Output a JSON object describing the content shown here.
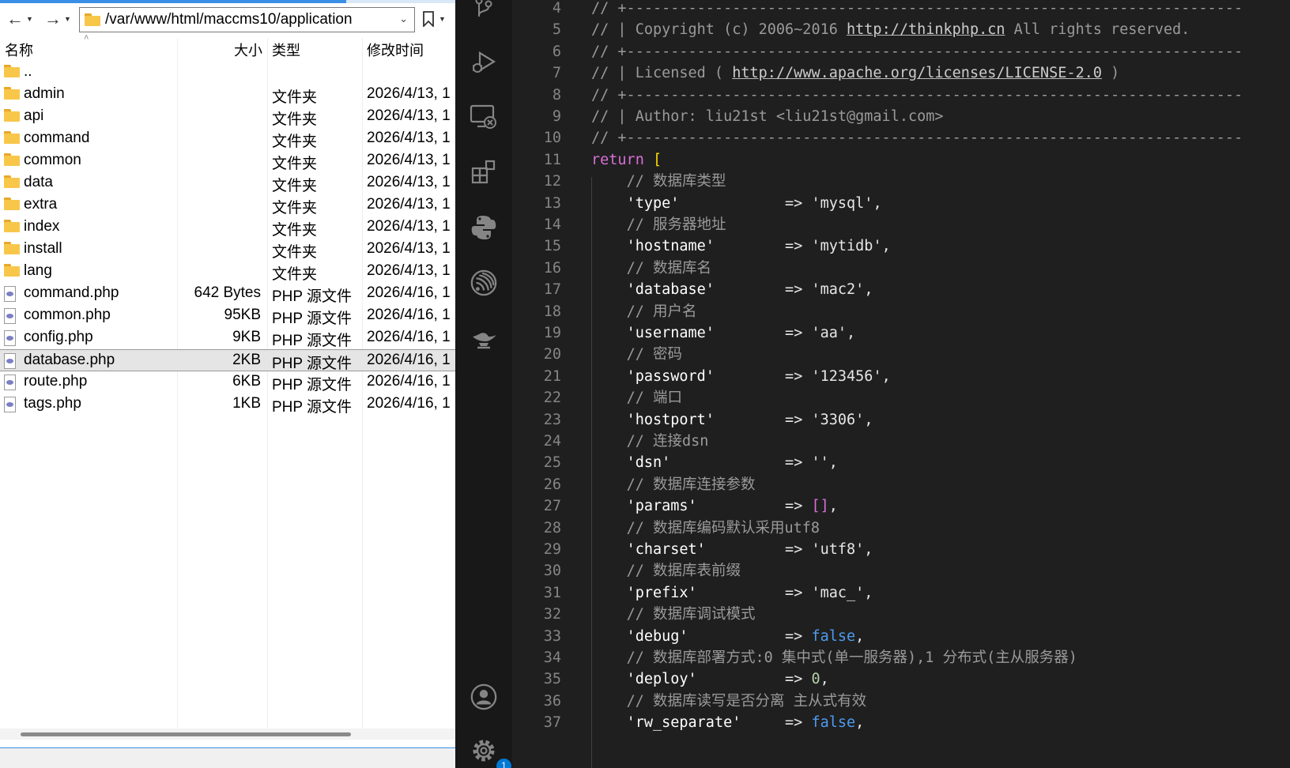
{
  "explorer": {
    "path": "/var/www/html/maccms10/application",
    "columns": {
      "name": "名称",
      "size": "大小",
      "type": "类型",
      "modified": "修改时间"
    },
    "files": [
      {
        "name": "..",
        "size": "",
        "type": "",
        "modified": "",
        "icon": "folder-icon",
        "selected": false
      },
      {
        "name": "admin",
        "size": "",
        "type": "文件夹",
        "modified": "2026/4/13, 1",
        "icon": "folder-icon",
        "selected": false
      },
      {
        "name": "api",
        "size": "",
        "type": "文件夹",
        "modified": "2026/4/13, 1",
        "icon": "folder-icon",
        "selected": false
      },
      {
        "name": "command",
        "size": "",
        "type": "文件夹",
        "modified": "2026/4/13, 1",
        "icon": "folder-icon",
        "selected": false
      },
      {
        "name": "common",
        "size": "",
        "type": "文件夹",
        "modified": "2026/4/13, 1",
        "icon": "folder-icon",
        "selected": false
      },
      {
        "name": "data",
        "size": "",
        "type": "文件夹",
        "modified": "2026/4/13, 1",
        "icon": "folder-icon",
        "selected": false
      },
      {
        "name": "extra",
        "size": "",
        "type": "文件夹",
        "modified": "2026/4/13, 1",
        "icon": "folder-icon",
        "selected": false
      },
      {
        "name": "index",
        "size": "",
        "type": "文件夹",
        "modified": "2026/4/13, 1",
        "icon": "folder-icon",
        "selected": false
      },
      {
        "name": "install",
        "size": "",
        "type": "文件夹",
        "modified": "2026/4/13, 1",
        "icon": "folder-icon",
        "selected": false
      },
      {
        "name": "lang",
        "size": "",
        "type": "文件夹",
        "modified": "2026/4/13, 1",
        "icon": "folder-icon",
        "selected": false
      },
      {
        "name": "command.php",
        "size": "642 Bytes",
        "type": "PHP 源文件",
        "modified": "2026/4/16, 1",
        "icon": "php-file-icon",
        "selected": false
      },
      {
        "name": "common.php",
        "size": "95KB",
        "type": "PHP 源文件",
        "modified": "2026/4/16, 1",
        "icon": "php-file-icon",
        "selected": false
      },
      {
        "name": "config.php",
        "size": "9KB",
        "type": "PHP 源文件",
        "modified": "2026/4/16, 1",
        "icon": "php-file-icon",
        "selected": false
      },
      {
        "name": "database.php",
        "size": "2KB",
        "type": "PHP 源文件",
        "modified": "2026/4/16, 1",
        "icon": "php-file-icon",
        "selected": true
      },
      {
        "name": "route.php",
        "size": "6KB",
        "type": "PHP 源文件",
        "modified": "2026/4/16, 1",
        "icon": "php-file-icon",
        "selected": false
      },
      {
        "name": "tags.php",
        "size": "1KB",
        "type": "PHP 源文件",
        "modified": "2026/4/16, 1",
        "icon": "php-file-icon",
        "selected": false
      }
    ]
  },
  "activity_bar": {
    "icons": [
      "source-control-icon",
      "run-debug-icon",
      "remote-explorer-icon",
      "extensions-icon",
      "python-icon",
      "esp-idf-icon",
      "genie-lamp-icon",
      "accounts-icon",
      "settings-gear-icon"
    ],
    "settings_badge": "1"
  },
  "editor": {
    "lines": [
      {
        "n": "4",
        "tokens": [
          [
            "cmt",
            "// +----------------------------------------------------------------------"
          ]
        ]
      },
      {
        "n": "5",
        "tokens": [
          [
            "cmt",
            "// | Copyright (c) 2006~2016 "
          ],
          [
            "link",
            "http://thinkphp.cn"
          ],
          [
            "cmt",
            " All rights reserved."
          ]
        ]
      },
      {
        "n": "6",
        "tokens": [
          [
            "cmt",
            "// +----------------------------------------------------------------------"
          ]
        ]
      },
      {
        "n": "7",
        "tokens": [
          [
            "cmt",
            "// | Licensed ( "
          ],
          [
            "link",
            "http://www.apache.org/licenses/LICENSE-2.0"
          ],
          [
            "cmt",
            " )"
          ]
        ]
      },
      {
        "n": "8",
        "tokens": [
          [
            "cmt",
            "// +----------------------------------------------------------------------"
          ]
        ]
      },
      {
        "n": "9",
        "tokens": [
          [
            "cmt",
            "// | Author: liu21st <liu21st@gmail.com>"
          ]
        ]
      },
      {
        "n": "10",
        "tokens": [
          [
            "cmt",
            "// +----------------------------------------------------------------------"
          ]
        ]
      },
      {
        "n": "11",
        "tokens": [
          [
            "kw",
            "return"
          ],
          [
            "op",
            " "
          ],
          [
            "brk",
            "["
          ]
        ]
      },
      {
        "n": "12",
        "tokens": [
          [
            "op",
            "    "
          ],
          [
            "cmt",
            "// 数据库类型"
          ]
        ]
      },
      {
        "n": "13",
        "tokens": [
          [
            "op",
            "    "
          ],
          [
            "key",
            "'type'"
          ],
          [
            "op",
            "            => "
          ],
          [
            "str",
            "'mysql'"
          ],
          [
            "op",
            ","
          ]
        ]
      },
      {
        "n": "14",
        "tokens": [
          [
            "op",
            "    "
          ],
          [
            "cmt",
            "// 服务器地址"
          ]
        ]
      },
      {
        "n": "15",
        "tokens": [
          [
            "op",
            "    "
          ],
          [
            "key",
            "'hostname'"
          ],
          [
            "op",
            "        => "
          ],
          [
            "str",
            "'mytidb'"
          ],
          [
            "op",
            ","
          ]
        ]
      },
      {
        "n": "16",
        "tokens": [
          [
            "op",
            "    "
          ],
          [
            "cmt",
            "// 数据库名"
          ]
        ]
      },
      {
        "n": "17",
        "tokens": [
          [
            "op",
            "    "
          ],
          [
            "key",
            "'database'"
          ],
          [
            "op",
            "        => "
          ],
          [
            "str",
            "'mac2'"
          ],
          [
            "op",
            ","
          ]
        ]
      },
      {
        "n": "18",
        "tokens": [
          [
            "op",
            "    "
          ],
          [
            "cmt",
            "// 用户名"
          ]
        ]
      },
      {
        "n": "19",
        "tokens": [
          [
            "op",
            "    "
          ],
          [
            "key",
            "'username'"
          ],
          [
            "op",
            "        => "
          ],
          [
            "str",
            "'aa'"
          ],
          [
            "op",
            ","
          ]
        ]
      },
      {
        "n": "20",
        "tokens": [
          [
            "op",
            "    "
          ],
          [
            "cmt",
            "// 密码"
          ]
        ]
      },
      {
        "n": "21",
        "tokens": [
          [
            "op",
            "    "
          ],
          [
            "key",
            "'password'"
          ],
          [
            "op",
            "        => "
          ],
          [
            "str",
            "'123456'"
          ],
          [
            "op",
            ","
          ]
        ]
      },
      {
        "n": "22",
        "tokens": [
          [
            "op",
            "    "
          ],
          [
            "cmt",
            "// 端口"
          ]
        ]
      },
      {
        "n": "23",
        "tokens": [
          [
            "op",
            "    "
          ],
          [
            "key",
            "'hostport'"
          ],
          [
            "op",
            "        => "
          ],
          [
            "str",
            "'3306'"
          ],
          [
            "op",
            ","
          ]
        ]
      },
      {
        "n": "24",
        "tokens": [
          [
            "op",
            "    "
          ],
          [
            "cmt",
            "// 连接dsn"
          ]
        ]
      },
      {
        "n": "25",
        "tokens": [
          [
            "op",
            "    "
          ],
          [
            "key",
            "'dsn'"
          ],
          [
            "op",
            "             => "
          ],
          [
            "str",
            "''"
          ],
          [
            "op",
            ","
          ]
        ]
      },
      {
        "n": "26",
        "tokens": [
          [
            "op",
            "    "
          ],
          [
            "cmt",
            "// 数据库连接参数"
          ]
        ]
      },
      {
        "n": "27",
        "tokens": [
          [
            "op",
            "    "
          ],
          [
            "key",
            "'params'"
          ],
          [
            "op",
            "          => "
          ],
          [
            "brk2",
            "[]"
          ],
          [
            "op",
            ","
          ]
        ]
      },
      {
        "n": "28",
        "tokens": [
          [
            "op",
            "    "
          ],
          [
            "cmt",
            "// 数据库编码默认采用utf8"
          ]
        ]
      },
      {
        "n": "29",
        "tokens": [
          [
            "op",
            "    "
          ],
          [
            "key",
            "'charset'"
          ],
          [
            "op",
            "         => "
          ],
          [
            "str",
            "'utf8'"
          ],
          [
            "op",
            ","
          ]
        ]
      },
      {
        "n": "30",
        "tokens": [
          [
            "op",
            "    "
          ],
          [
            "cmt",
            "// 数据库表前缀"
          ]
        ]
      },
      {
        "n": "31",
        "tokens": [
          [
            "op",
            "    "
          ],
          [
            "key",
            "'prefix'"
          ],
          [
            "op",
            "          => "
          ],
          [
            "str",
            "'mac_'"
          ],
          [
            "op",
            ","
          ]
        ]
      },
      {
        "n": "32",
        "tokens": [
          [
            "op",
            "    "
          ],
          [
            "cmt",
            "// 数据库调试模式"
          ]
        ]
      },
      {
        "n": "33",
        "tokens": [
          [
            "op",
            "    "
          ],
          [
            "key",
            "'debug'"
          ],
          [
            "op",
            "           => "
          ],
          [
            "bool",
            "false"
          ],
          [
            "op",
            ","
          ]
        ]
      },
      {
        "n": "34",
        "tokens": [
          [
            "op",
            "    "
          ],
          [
            "cmt",
            "// 数据库部署方式:0 集中式(单一服务器),1 分布式(主从服务器)"
          ]
        ]
      },
      {
        "n": "35",
        "tokens": [
          [
            "op",
            "    "
          ],
          [
            "key",
            "'deploy'"
          ],
          [
            "op",
            "          => "
          ],
          [
            "num",
            "0"
          ],
          [
            "op",
            ","
          ]
        ]
      },
      {
        "n": "36",
        "tokens": [
          [
            "op",
            "    "
          ],
          [
            "cmt",
            "// 数据库读写是否分离 主从式有效"
          ]
        ]
      },
      {
        "n": "37",
        "tokens": [
          [
            "op",
            "    "
          ],
          [
            "key",
            "'rw_separate'"
          ],
          [
            "op",
            "     => "
          ],
          [
            "bool",
            "false"
          ],
          [
            "op",
            ","
          ]
        ]
      }
    ]
  }
}
